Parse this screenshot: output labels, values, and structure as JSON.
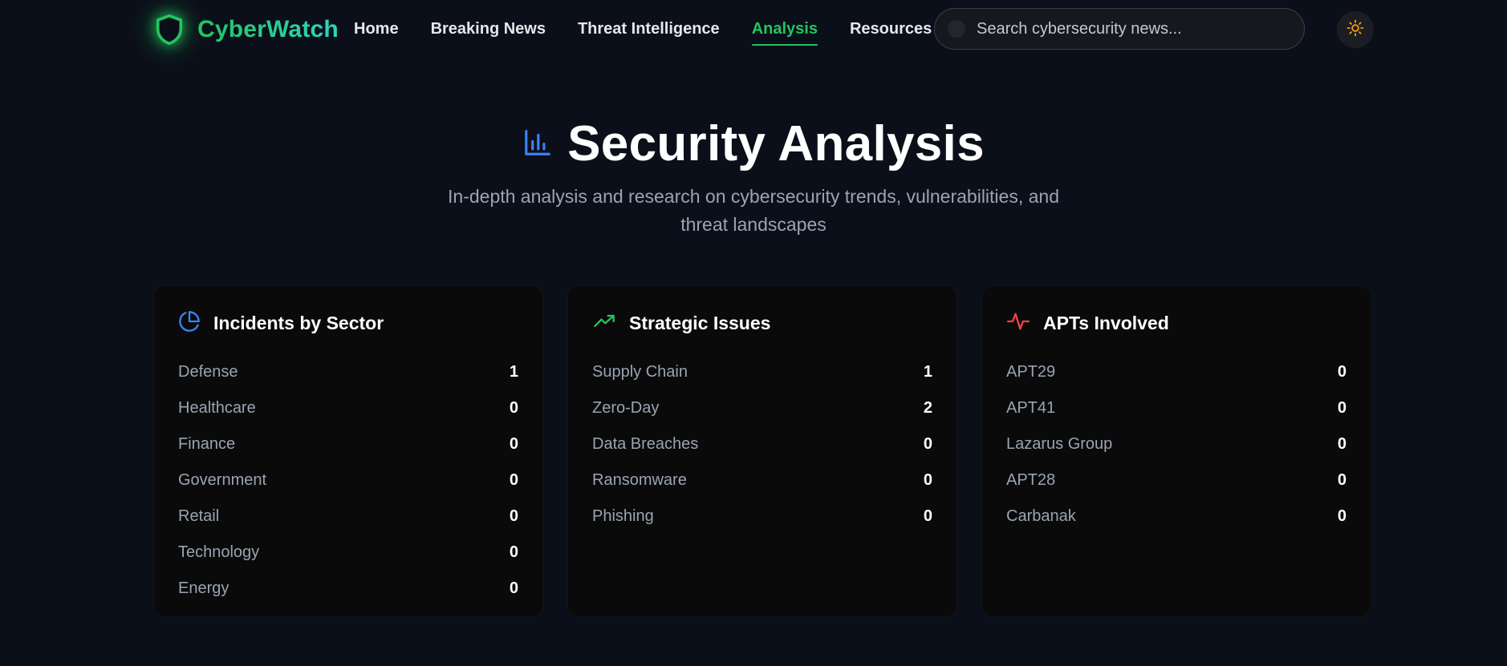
{
  "brand": {
    "name": "CyberWatch",
    "logo_icon": "shield-icon",
    "accent": "#22c55e"
  },
  "nav": {
    "items": [
      {
        "label": "Home"
      },
      {
        "label": "Breaking News"
      },
      {
        "label": "Threat Intelligence"
      },
      {
        "label": "Analysis",
        "active": true
      },
      {
        "label": "Resources"
      }
    ]
  },
  "search": {
    "placeholder": "Search cybersecurity news...",
    "value": ""
  },
  "theme_toggle": {
    "icon": "sun-icon",
    "color": "#f59e0b"
  },
  "hero": {
    "icon": "bar-chart-icon",
    "title": "Security Analysis",
    "subtitle": "In-depth analysis and research on cybersecurity trends, vulnerabilities, and threat landscapes"
  },
  "cards": [
    {
      "title": "Incidents by Sector",
      "icon": "pie-chart-icon",
      "icon_color": "#3b82f6",
      "rows": [
        {
          "label": "Defense",
          "value": "1"
        },
        {
          "label": "Healthcare",
          "value": "0"
        },
        {
          "label": "Finance",
          "value": "0"
        },
        {
          "label": "Government",
          "value": "0"
        },
        {
          "label": "Retail",
          "value": "0"
        },
        {
          "label": "Technology",
          "value": "0"
        },
        {
          "label": "Energy",
          "value": "0"
        }
      ]
    },
    {
      "title": "Strategic Issues",
      "icon": "trending-up-icon",
      "icon_color": "#22c55e",
      "rows": [
        {
          "label": "Supply Chain",
          "value": "1"
        },
        {
          "label": "Zero-Day",
          "value": "2"
        },
        {
          "label": "Data Breaches",
          "value": "0"
        },
        {
          "label": "Ransomware",
          "value": "0"
        },
        {
          "label": "Phishing",
          "value": "0"
        }
      ]
    },
    {
      "title": "APTs Involved",
      "icon": "activity-icon",
      "icon_color": "#ef4444",
      "rows": [
        {
          "label": "APT29",
          "value": "0"
        },
        {
          "label": "APT41",
          "value": "0"
        },
        {
          "label": "Lazarus Group",
          "value": "0"
        },
        {
          "label": "APT28",
          "value": "0"
        },
        {
          "label": "Carbanak",
          "value": "0"
        }
      ]
    }
  ]
}
